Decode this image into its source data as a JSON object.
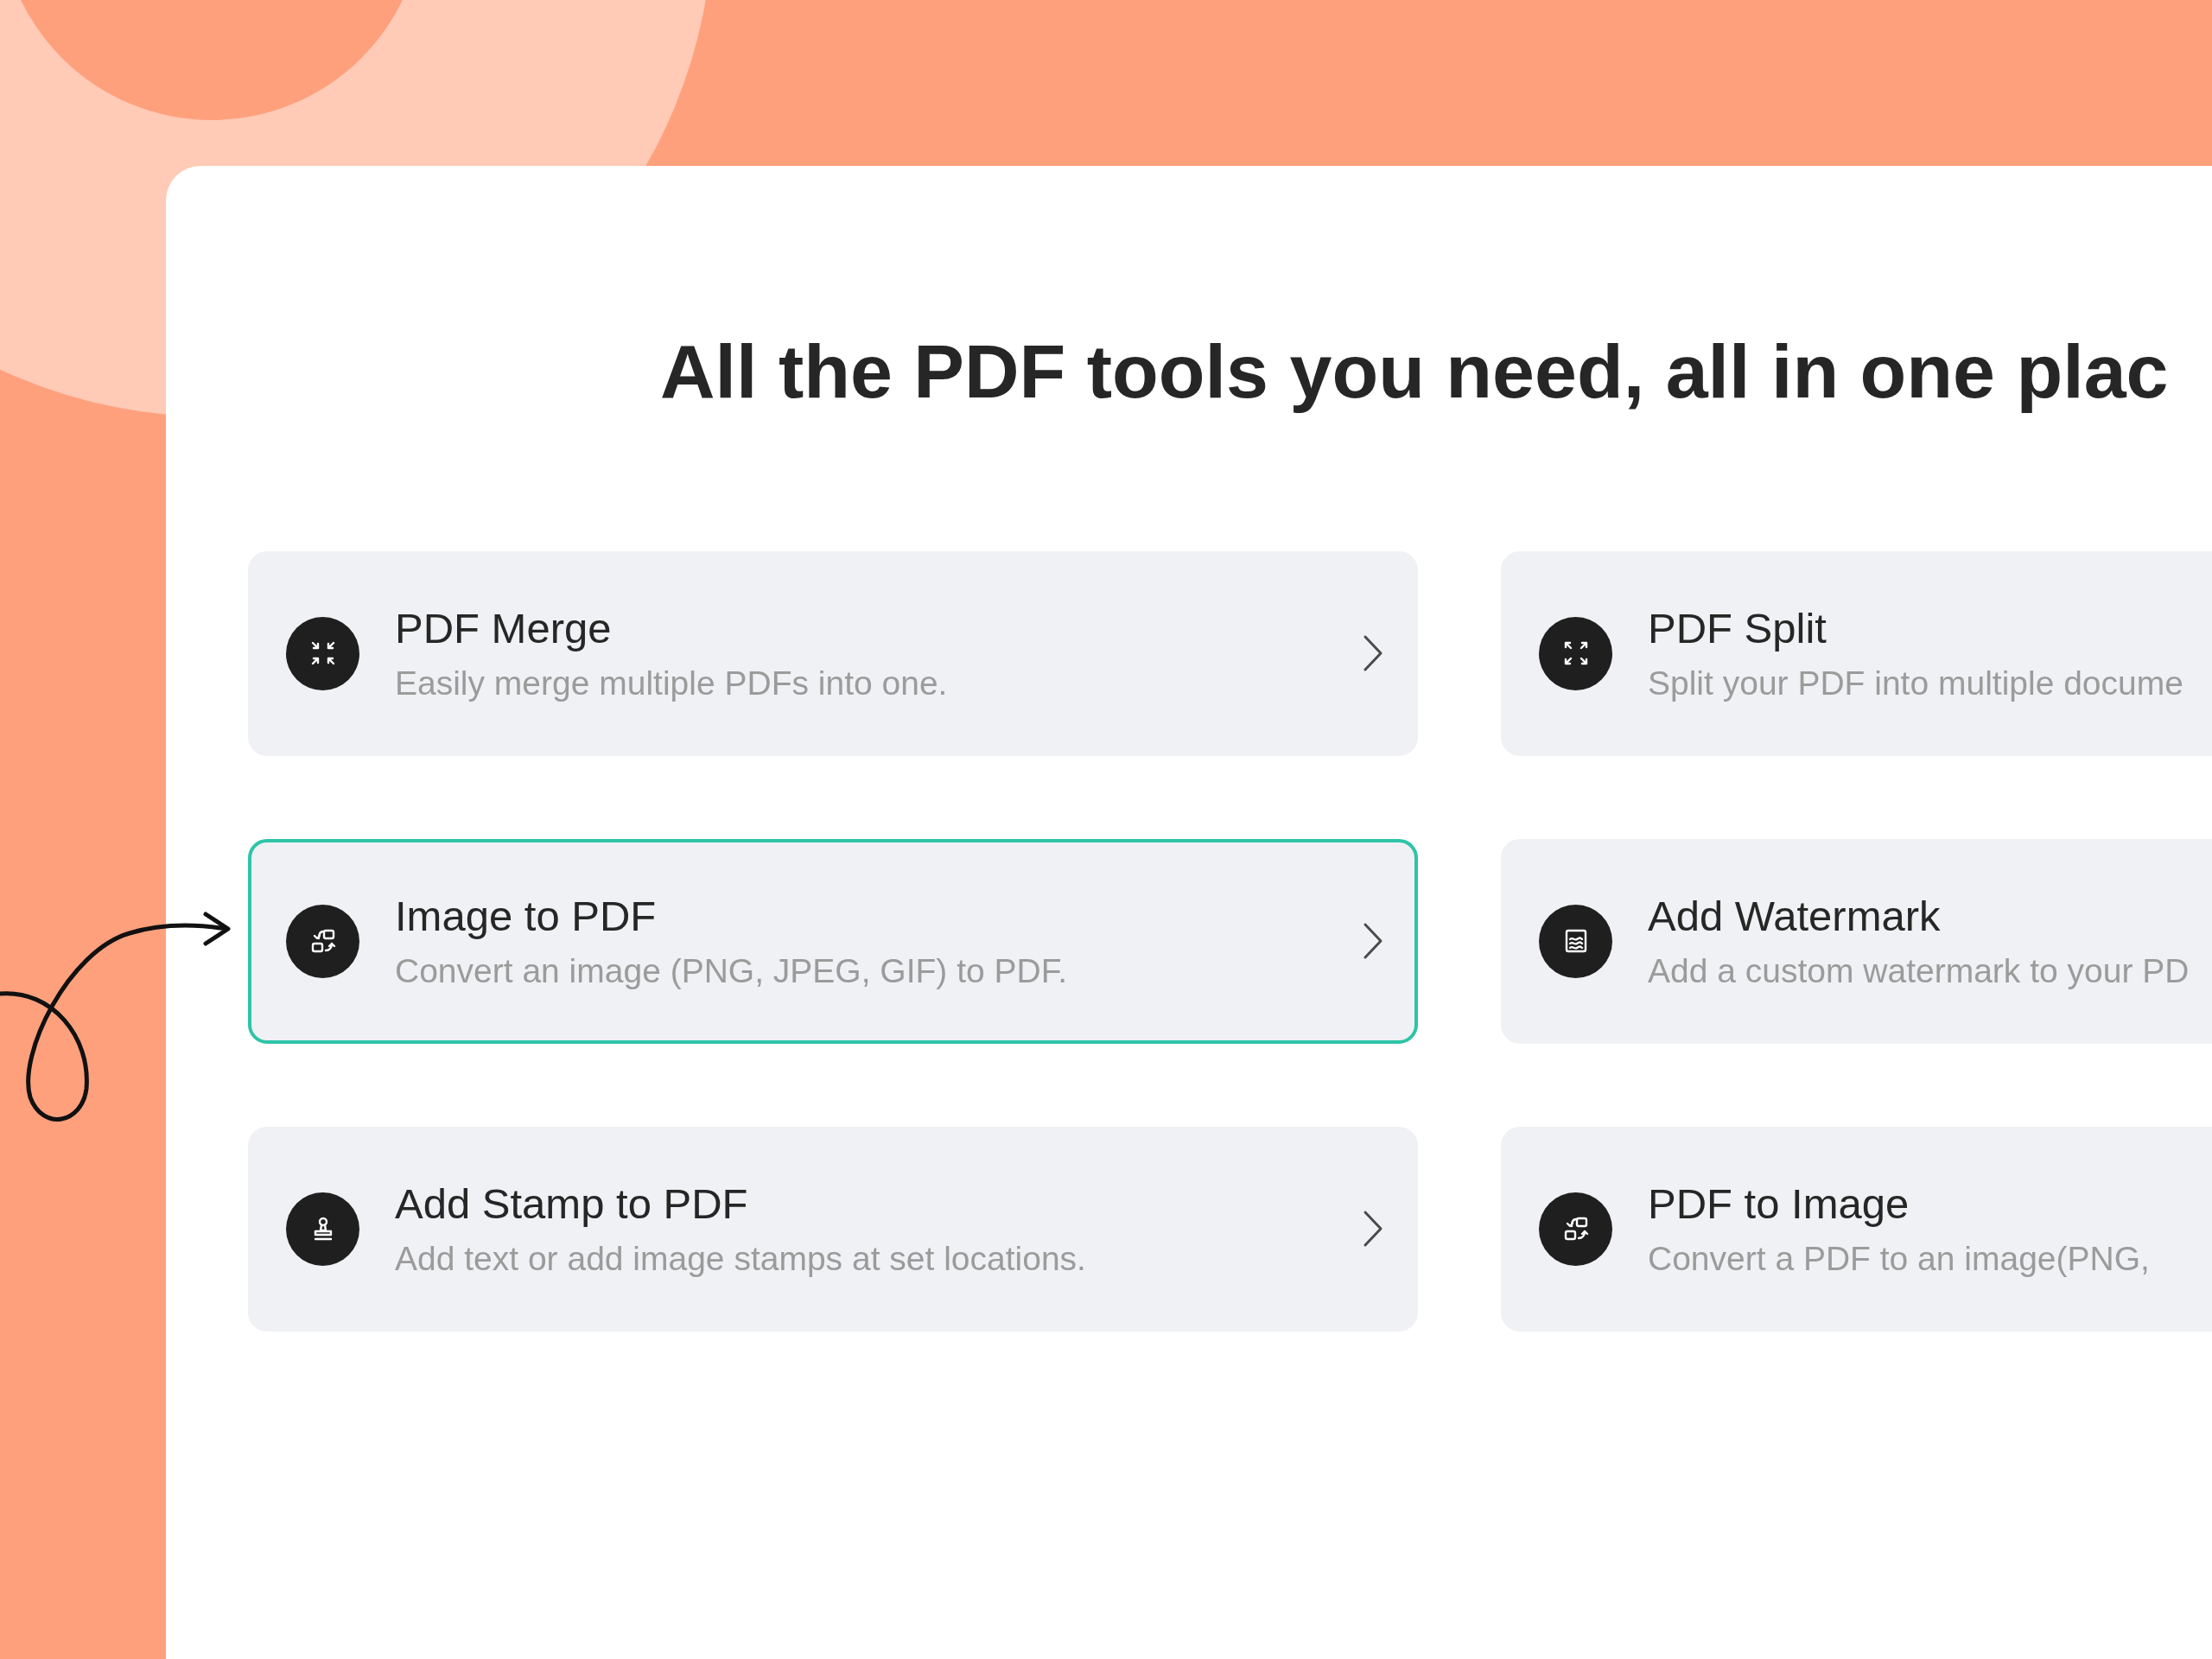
{
  "heading": "All the PDF tools you need, all in one plac",
  "tools": [
    {
      "title": "PDF Merge",
      "description": "Easily merge multiple PDFs into one.",
      "selected": false
    },
    {
      "title": "PDF Split",
      "description": "Split your PDF into multiple docume",
      "selected": false
    },
    {
      "title": "Image to PDF",
      "description": "Convert an image (PNG, JPEG, GIF) to PDF.",
      "selected": true
    },
    {
      "title": "Add Watermark",
      "description": "Add a custom watermark to your PD",
      "selected": false
    },
    {
      "title": "Add Stamp to PDF",
      "description": "Add text or add image stamps at set locations.",
      "selected": false
    },
    {
      "title": "PDF to Image",
      "description": "Convert a PDF to an image(PNG,",
      "selected": false
    }
  ]
}
